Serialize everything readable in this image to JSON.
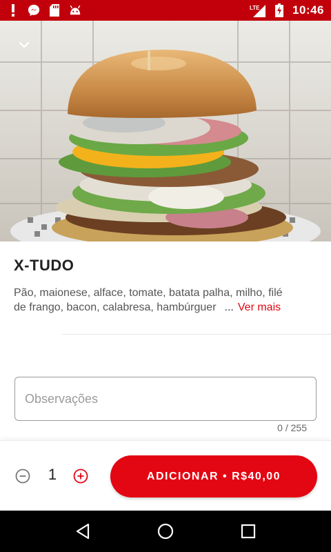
{
  "status_bar": {
    "time": "10:46",
    "network": "LTE",
    "left_icons": [
      "alert-icon",
      "messenger-icon",
      "sd-card-icon",
      "android-icon"
    ],
    "right_icons": [
      "signal-icon",
      "battery-charging-icon"
    ]
  },
  "hero": {
    "image_description_icon": "burger-photo",
    "collapse_icon": "chevron-down-icon"
  },
  "product": {
    "title": "X-TUDO",
    "description_line1": "Pão, maionese, alface, tomate, batata palha, milho, filé",
    "description_line2": "de frango, bacon, calabresa, hambúrguer",
    "ellipsis": "...",
    "see_more": "Ver mais"
  },
  "observations": {
    "placeholder": "Observações",
    "value": "",
    "counter": "0 / 255"
  },
  "cart": {
    "quantity": "1",
    "add_button_label": "ADICIONAR • R$40,00"
  },
  "colors": {
    "status_bar": "#c2000b",
    "accent": "#e30613",
    "nav_bar": "#000000"
  },
  "nav_bar": {
    "icons": [
      "back-icon",
      "home-icon",
      "recents-icon"
    ]
  }
}
